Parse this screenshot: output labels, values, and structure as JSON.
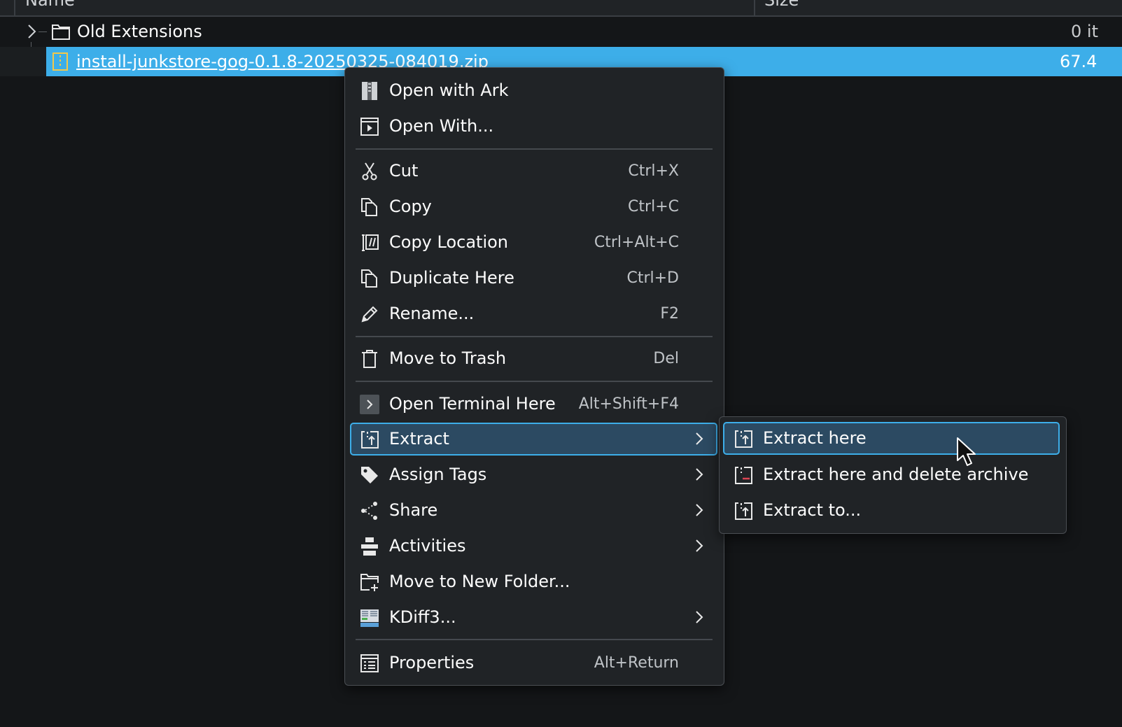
{
  "columns": {
    "name": "Name",
    "size": "Size"
  },
  "files": [
    {
      "name": "Old Extensions",
      "size": "0 it",
      "type": "folder"
    },
    {
      "name": "install-junkstore-gog-0.1.8-20250325-084019.zip",
      "size": "67.4",
      "type": "archive",
      "selected": true
    }
  ],
  "context_menu": {
    "items": [
      {
        "label": "Open with Ark",
        "shortcut": "",
        "icon": "ark-archive-icon"
      },
      {
        "label": "Open With...",
        "shortcut": "",
        "icon": "open-with-icon"
      },
      {
        "label": "Cut",
        "shortcut": "Ctrl+X",
        "icon": "scissors-icon"
      },
      {
        "label": "Copy",
        "shortcut": "Ctrl+C",
        "icon": "copy-icon"
      },
      {
        "label": "Copy Location",
        "shortcut": "Ctrl+Alt+C",
        "icon": "copy-location-icon"
      },
      {
        "label": "Duplicate Here",
        "shortcut": "Ctrl+D",
        "icon": "duplicate-icon"
      },
      {
        "label": "Rename...",
        "shortcut": "F2",
        "icon": "pencil-icon"
      },
      {
        "label": "Move to Trash",
        "shortcut": "Del",
        "icon": "trash-icon"
      },
      {
        "label": "Open Terminal Here",
        "shortcut": "Alt+Shift+F4",
        "icon": "terminal-icon"
      },
      {
        "label": "Extract",
        "shortcut": "",
        "icon": "extract-icon",
        "submenu": true,
        "highlighted": true
      },
      {
        "label": "Assign Tags",
        "shortcut": "",
        "icon": "tag-icon",
        "submenu": true
      },
      {
        "label": "Share",
        "shortcut": "",
        "icon": "share-icon",
        "submenu": true
      },
      {
        "label": "Activities",
        "shortcut": "",
        "icon": "activities-icon",
        "submenu": true
      },
      {
        "label": "Move to New Folder...",
        "shortcut": "",
        "icon": "new-folder-icon"
      },
      {
        "label": "KDiff3...",
        "shortcut": "",
        "icon": "kdiff3-icon",
        "submenu": true
      },
      {
        "label": "Properties",
        "shortcut": "Alt+Return",
        "icon": "properties-icon"
      }
    ]
  },
  "extract_submenu": {
    "items": [
      {
        "label": "Extract here",
        "icon": "extract-icon",
        "highlighted": true
      },
      {
        "label": "Extract here and delete archive",
        "icon": "extract-delete-icon"
      },
      {
        "label": "Extract to...",
        "icon": "extract-icon"
      }
    ]
  },
  "colors": {
    "background": "#141618",
    "menu_background": "#202326",
    "selection": "#3daee9",
    "highlight_fill": "#2c4a62"
  }
}
